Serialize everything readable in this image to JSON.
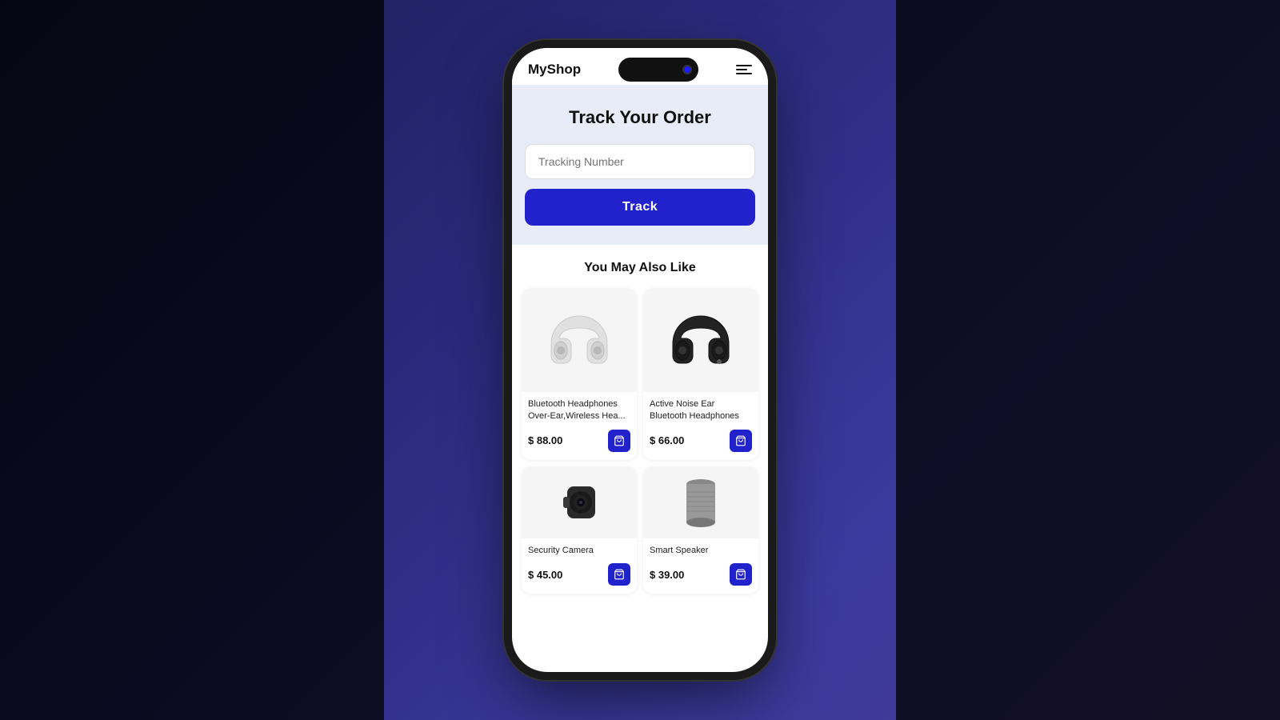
{
  "app": {
    "title": "MyShop",
    "menu_icon": "hamburger-icon"
  },
  "track_section": {
    "heading": "Track Your Order",
    "input_placeholder": "Tracking Number",
    "button_label": "Track"
  },
  "recommendations": {
    "heading": "You May Also Like",
    "products": [
      {
        "id": 1,
        "name": "Bluetooth Headphones Over-Ear,Wireless Hea...",
        "price": "$ 88.00",
        "type": "headphone-white",
        "cart_label": "add to cart"
      },
      {
        "id": 2,
        "name": "Active Noise Ear Bluetooth Headphones",
        "price": "$ 66.00",
        "type": "headphone-black",
        "cart_label": "add to cart"
      },
      {
        "id": 3,
        "name": "Security Camera",
        "price": "$ 45.00",
        "type": "camera-black",
        "cart_label": "add to cart"
      },
      {
        "id": 4,
        "name": "Smart Speaker",
        "price": "$ 39.00",
        "type": "speaker-gray",
        "cart_label": "add to cart"
      }
    ]
  }
}
